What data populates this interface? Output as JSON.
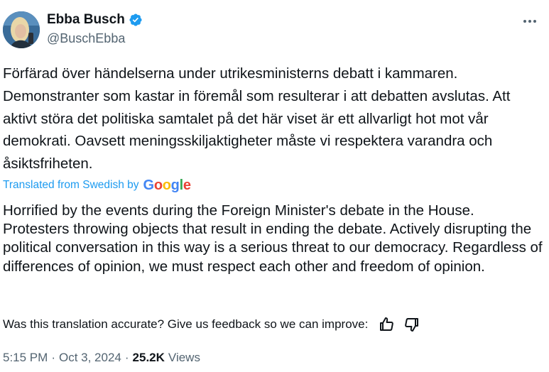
{
  "author": {
    "name": "Ebba Busch",
    "handle": "@BuschEbba",
    "verified": true
  },
  "tweet": {
    "original_text": "Förfärad över händelserna under utrikesministerns debatt i kammaren. Demonstranter som kastar in föremål som resulterar i att debatten avslutas. Att aktivt störa det politiska samtalet på det här viset är ett allvarligt hot mot vår demokrati. Oavsett meningsskiljaktigheter måste vi respektera varandra och åsiktsfriheten.",
    "translated_from_label": "Translated from Swedish by",
    "translator_brand": "Google",
    "translated_text": "Horrified by the events during the Foreign Minister's debate in the House. Protesters throwing objects that result in ending the debate. Actively disrupting the political conversation in this way is a serious threat to our democracy. Regardless of differences of opinion, we must respect each other and freedom of opinion."
  },
  "feedback": {
    "prompt": "Was this translation accurate? Give us feedback so we can improve:"
  },
  "meta": {
    "time": "5:15 PM",
    "date": "Oct 3, 2024",
    "views_count": "25.2K",
    "views_label": "Views",
    "separator": "·"
  },
  "colors": {
    "link": "#1d9bf0",
    "secondary_text": "#536471",
    "primary_text": "#0f1419",
    "verified_badge": "#1d9bf0"
  },
  "icons": {
    "verified": "verified-badge-icon",
    "more": "more-horizontal-icon",
    "thumbs_up": "thumbs-up-icon",
    "thumbs_down": "thumbs-down-icon"
  }
}
